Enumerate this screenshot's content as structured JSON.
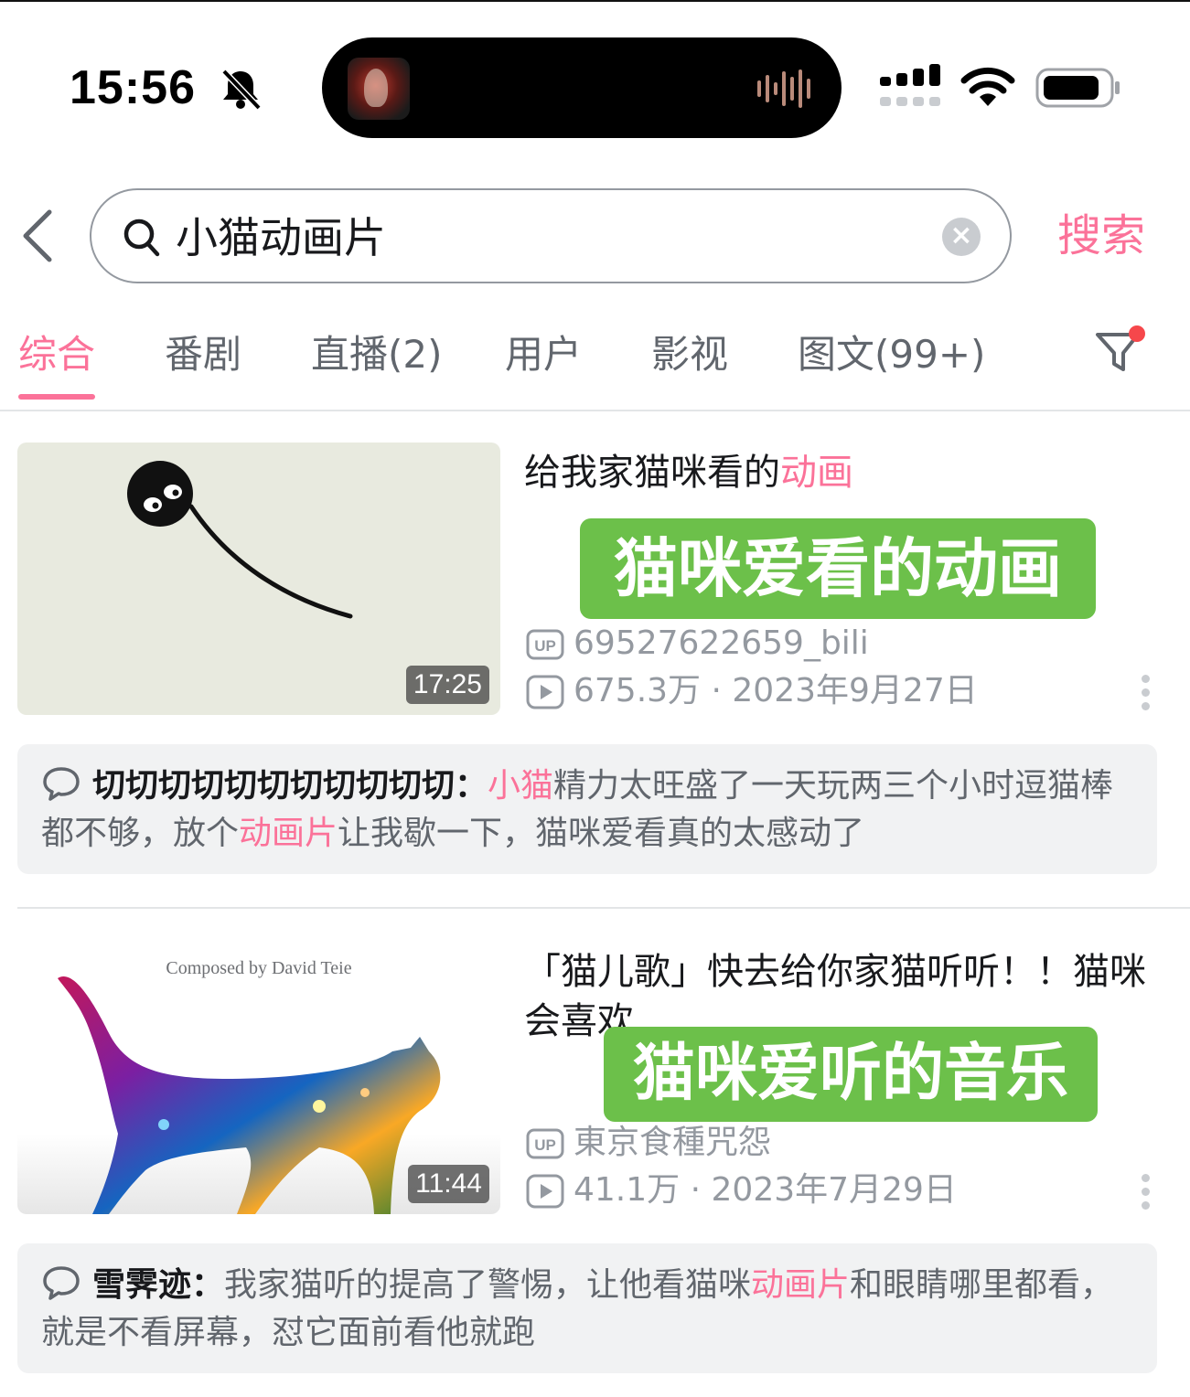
{
  "status_bar": {
    "time": "15:56",
    "icons": [
      "bell-slash-icon",
      "signal-icon",
      "wifi-icon",
      "battery-icon"
    ]
  },
  "search": {
    "query": "小猫动画片",
    "submit_label": "搜索"
  },
  "tabs": [
    {
      "label": "综合",
      "active": true
    },
    {
      "label": "番剧",
      "active": false
    },
    {
      "label": "直播(2)",
      "active": false
    },
    {
      "label": "用户",
      "active": false
    },
    {
      "label": "影视",
      "active": false
    },
    {
      "label": "图文(99+)",
      "active": false
    }
  ],
  "results": [
    {
      "title_plain": "给我家猫咪看的",
      "title_highlight": "动画",
      "overlay_text": "猫咪爱看的动画",
      "duration": "17:25",
      "uploader": "69527622659_bili",
      "views": "675.3万",
      "date": "2023年9月27日",
      "comment": {
        "user": "切切切切切切切切切切切：",
        "parts": [
          "",
          "小猫",
          "精力太旺盛了一天玩两三个小时逗猫棒都不够，放个",
          "动画片",
          "让我歇一下，猫咪爱看真的太感动了"
        ]
      }
    },
    {
      "title_plain": "「猫儿歌」快去给你家猫听听！！猫咪会喜欢",
      "title_highlight": "",
      "overlay_text": "猫咪爱听的音乐",
      "thumb_caption": "Composed by David Teie",
      "duration": "11:44",
      "uploader": "東京食種咒怨",
      "views": "41.1万",
      "date": "2023年7月29日",
      "comment": {
        "user": "雪霁迹：",
        "parts": [
          "我家猫听的提高了警惕，让他看猫咪",
          "动画片",
          "和眼睛哪里都看，就是不看屏幕，怼它面前看他就跑"
        ]
      }
    }
  ],
  "colors": {
    "accent": "#fb7299",
    "overlay_green": "#6cc04a",
    "text_secondary": "#9499a0"
  }
}
